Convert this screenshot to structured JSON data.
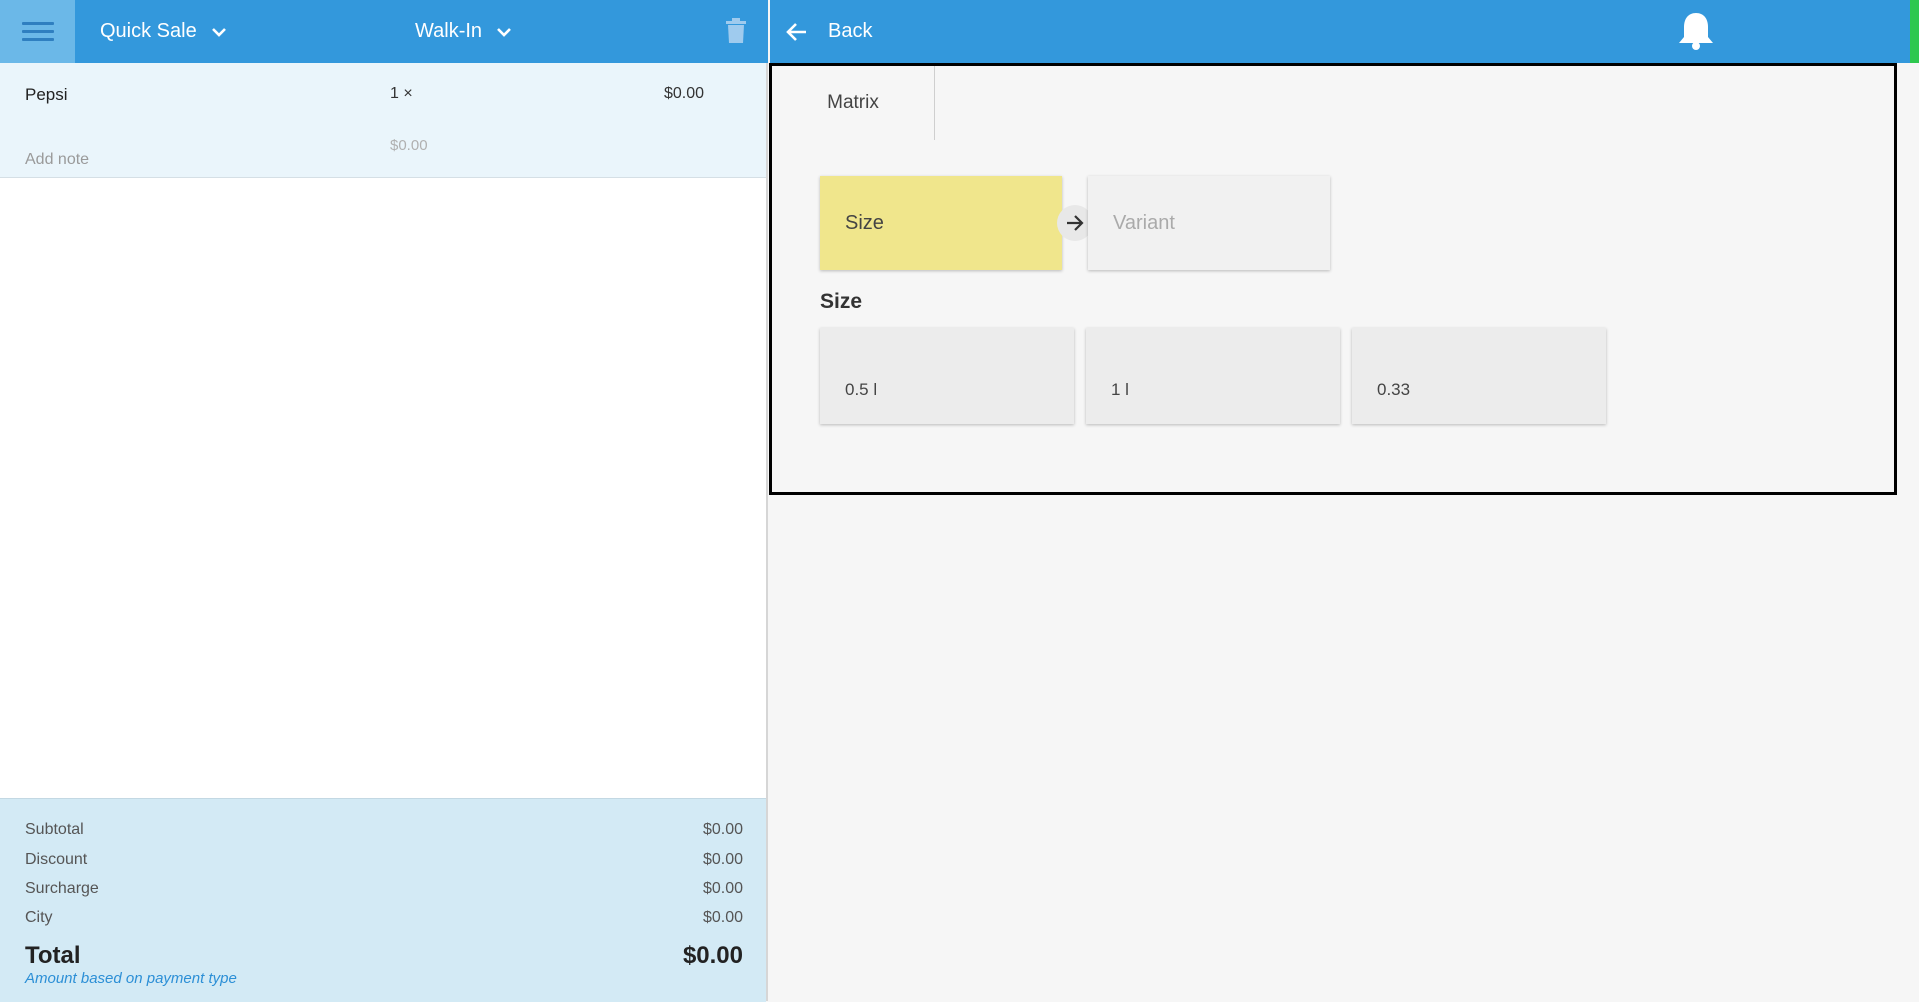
{
  "left_header": {
    "menu_icon": "hamburger-icon",
    "sale_type": "Quick Sale",
    "customer": "Walk-In",
    "trash_icon": "trash-icon",
    "header_color": "#3398dc"
  },
  "order_item": {
    "name": "Pepsi",
    "qty": "1 ×",
    "price": "$0.00",
    "note_placeholder": "Add note",
    "sub_price": "$0.00"
  },
  "totals": {
    "rows": [
      {
        "label": "Subtotal",
        "value": "$0.00"
      },
      {
        "label": "Discount",
        "value": "$0.00"
      },
      {
        "label": "Surcharge",
        "value": "$0.00"
      },
      {
        "label": "City",
        "value": "$0.00"
      }
    ],
    "total_label": "Total",
    "total_value": "$0.00",
    "note": "Amount based on payment type"
  },
  "right_header": {
    "back_label": "Back",
    "back_icon": "arrow-left-icon",
    "bell_icon": "bell-icon",
    "status_color": "#2ec84f"
  },
  "matrix": {
    "tab_label": "Matrix",
    "steps": [
      {
        "label": "Size",
        "state": "active",
        "color": "#f0e68c"
      },
      {
        "label": "Variant",
        "state": "inactive"
      }
    ],
    "arrow_icon": "arrow-right-icon",
    "section_title": "Size",
    "options": [
      "0.5 l",
      "1 l",
      "0.33"
    ]
  }
}
